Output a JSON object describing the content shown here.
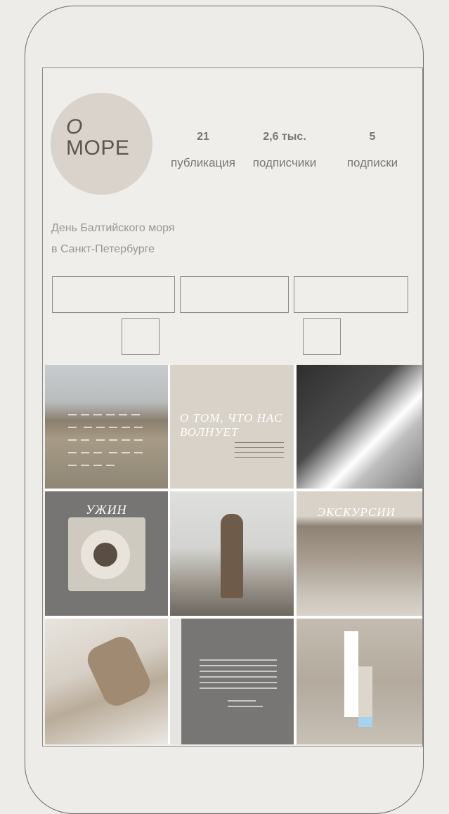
{
  "profile": {
    "avatar_line1": "О",
    "avatar_line2": "МОРЕ",
    "stats": [
      {
        "value": "21",
        "label": "публикация"
      },
      {
        "value": "2,6 тыс.",
        "label": "подписчики"
      },
      {
        "value": "5",
        "label": "подписки"
      }
    ],
    "bio_line1": "День Балтийского моря",
    "bio_line2": "в Санкт-Петербурге"
  },
  "posts": {
    "tile2_title": "О ТОМ, ЧТО НАС ВОЛНУЕТ",
    "tile4_title": "УЖИН",
    "tile6_title": "ЭКСКУРСИИ"
  },
  "colors": {
    "background": "#eeece9",
    "avatar": "#d9d3cc",
    "frame": "#6a6a6a"
  }
}
